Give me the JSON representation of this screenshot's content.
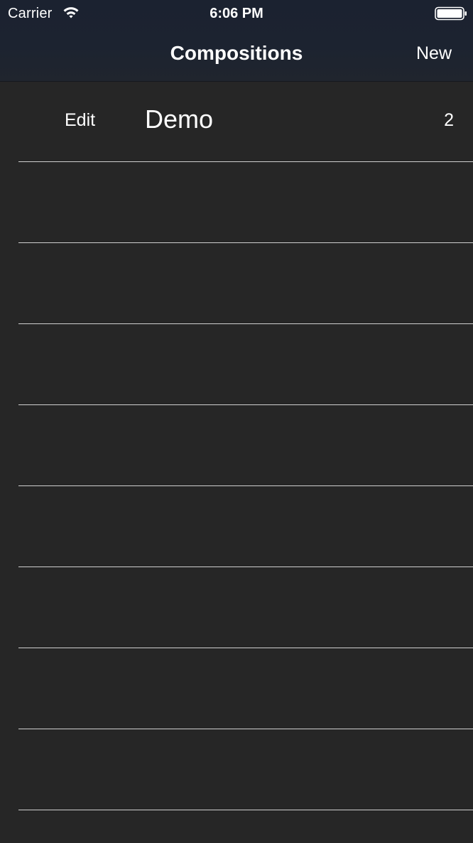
{
  "status_bar": {
    "carrier": "Carrier",
    "time": "6:06 PM",
    "wifi_icon": "wifi-icon",
    "battery_icon": "battery-full-icon"
  },
  "nav": {
    "title": "Compositions",
    "new_label": "New"
  },
  "colors": {
    "background": "#262626",
    "nav_background": "#1c2330",
    "text": "#ffffff",
    "separator": "#cfcfcf"
  },
  "compositions": [
    {
      "edit_label": "Edit",
      "name": "Demo",
      "count": "2"
    },
    {
      "edit_label": "",
      "name": "",
      "count": ""
    },
    {
      "edit_label": "",
      "name": "",
      "count": ""
    },
    {
      "edit_label": "",
      "name": "",
      "count": ""
    },
    {
      "edit_label": "",
      "name": "",
      "count": ""
    },
    {
      "edit_label": "",
      "name": "",
      "count": ""
    },
    {
      "edit_label": "",
      "name": "",
      "count": ""
    },
    {
      "edit_label": "",
      "name": "",
      "count": ""
    },
    {
      "edit_label": "",
      "name": "",
      "count": ""
    }
  ]
}
